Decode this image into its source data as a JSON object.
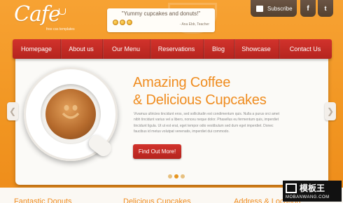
{
  "brand": {
    "name": "Cafe",
    "tagline": "free css templates"
  },
  "quote": {
    "text": "\"Yummy cupcakes and donuts!\"",
    "author": "- Ana Ebb, Teacher"
  },
  "header_actions": {
    "subscribe_label": "Subscribe",
    "facebook_label": "f",
    "twitter_label": "t"
  },
  "nav": {
    "items": [
      "Homepage",
      "About us",
      "Our Menu",
      "Reservations",
      "Blog",
      "Showcase",
      "Contact Us"
    ]
  },
  "hero": {
    "title_line1": "Amazing Coffee",
    "title_line2": "& Delicious Cupcakes",
    "body": "Vivamus ultricies tincidunt eros, sed sollicitudin est condimentum quis. Nulla a purus orci amet nibh tincidunt varius vel a libero, nonceu neque dolor. Phasellus eu fermentum quis, imperdiet tincidunt ligula. Ut ut est erat, eget tempor odio vestibulum sed dum eget imperdiet. Donec faucibus id metus volutpat venenatis, imperdiet dui commodo.",
    "cta_label": "Find Out More!",
    "slides_total": 3,
    "active_slide": 2
  },
  "bottom": {
    "columns": [
      "Fantastic Donuts",
      "Delicious Cupcakes",
      "Address & Location"
    ]
  },
  "watermark": {
    "big": "模板王",
    "small": "MOBANWANG.COM"
  },
  "colors": {
    "orange": "#f19521",
    "red": "#c22a24",
    "brown": "#5e4938",
    "cream": "#fbfaf7"
  }
}
